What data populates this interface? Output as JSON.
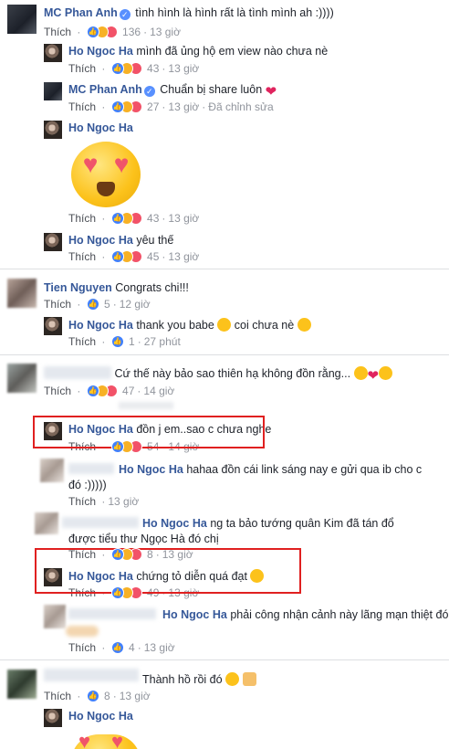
{
  "like_label": "Thích",
  "comments": [
    {
      "name": "MC Phan Anh",
      "text": "tình hình là hình rất là tình mình ah :))))",
      "count": "136",
      "time": "13 giờ"
    },
    {
      "name": "Ho Ngoc Ha",
      "text": "mình đã ủng hộ em view nào chưa nè",
      "count": "43",
      "time": "13 giờ"
    },
    {
      "name": "MC Phan Anh",
      "text": "Chuẩn bị share luôn",
      "count": "27",
      "time": "13 giờ",
      "edited": "Đã chỉnh sửa"
    },
    {
      "name": "Ho Ngoc Ha",
      "text": "",
      "count": "43",
      "time": "13 giờ"
    },
    {
      "name": "Ho Ngoc Ha",
      "text": "yêu thế",
      "count": "45",
      "time": "13 giờ"
    },
    {
      "name": "Tien Nguyen",
      "text": "Congrats chi!!!",
      "count": "5",
      "time": "12 giờ"
    },
    {
      "name": "Ho Ngoc Ha",
      "text": "thank you babe",
      "text2": "coi chưa nè",
      "count": "1",
      "time": "27 phút"
    },
    {
      "name": "",
      "text": "Cứ thế này bảo sao thiên hạ không đồn rằng...",
      "count": "47",
      "time": "14 giờ"
    },
    {
      "name": "Ho Ngoc Ha",
      "text": "đồn j em..sao c chưa nghe",
      "count": "54",
      "time": "14 giờ"
    },
    {
      "name": "Ho Ngoc Ha",
      "text": "hahaa đồn cái link sáng nay e gửi qua ib cho c",
      "text2": "đó :)))))",
      "time": "13 giờ"
    },
    {
      "name": "Ho Ngoc Ha",
      "text": "ng ta bảo tướng quân Kim đã tán đổ",
      "text2": "được tiểu thư Ngọc Hà đó chị",
      "count": "8",
      "time": "13 giờ"
    },
    {
      "name": "Ho Ngoc Ha",
      "text": "chứng tỏ diễn quá đạt",
      "count": "49",
      "time": "13 giờ"
    },
    {
      "name": "Ho Ngoc Ha",
      "text": "phải công nhận cảnh này lãng mạn thiệt đó c ạ",
      "count": "4",
      "time": "13 giờ"
    },
    {
      "name": "",
      "text": "Thành hồ rồi đó",
      "count": "8",
      "time": "13 giờ"
    },
    {
      "name": "Ho Ngoc Ha",
      "text": ""
    }
  ],
  "icons": {
    "like": "like-reaction-icon",
    "haha": "haha-reaction-icon",
    "love": "love-reaction-icon",
    "verified": "verified-badge-icon"
  },
  "colors": {
    "name": "#365899",
    "meta": "#90949c",
    "highlight_box": "#e02020"
  }
}
